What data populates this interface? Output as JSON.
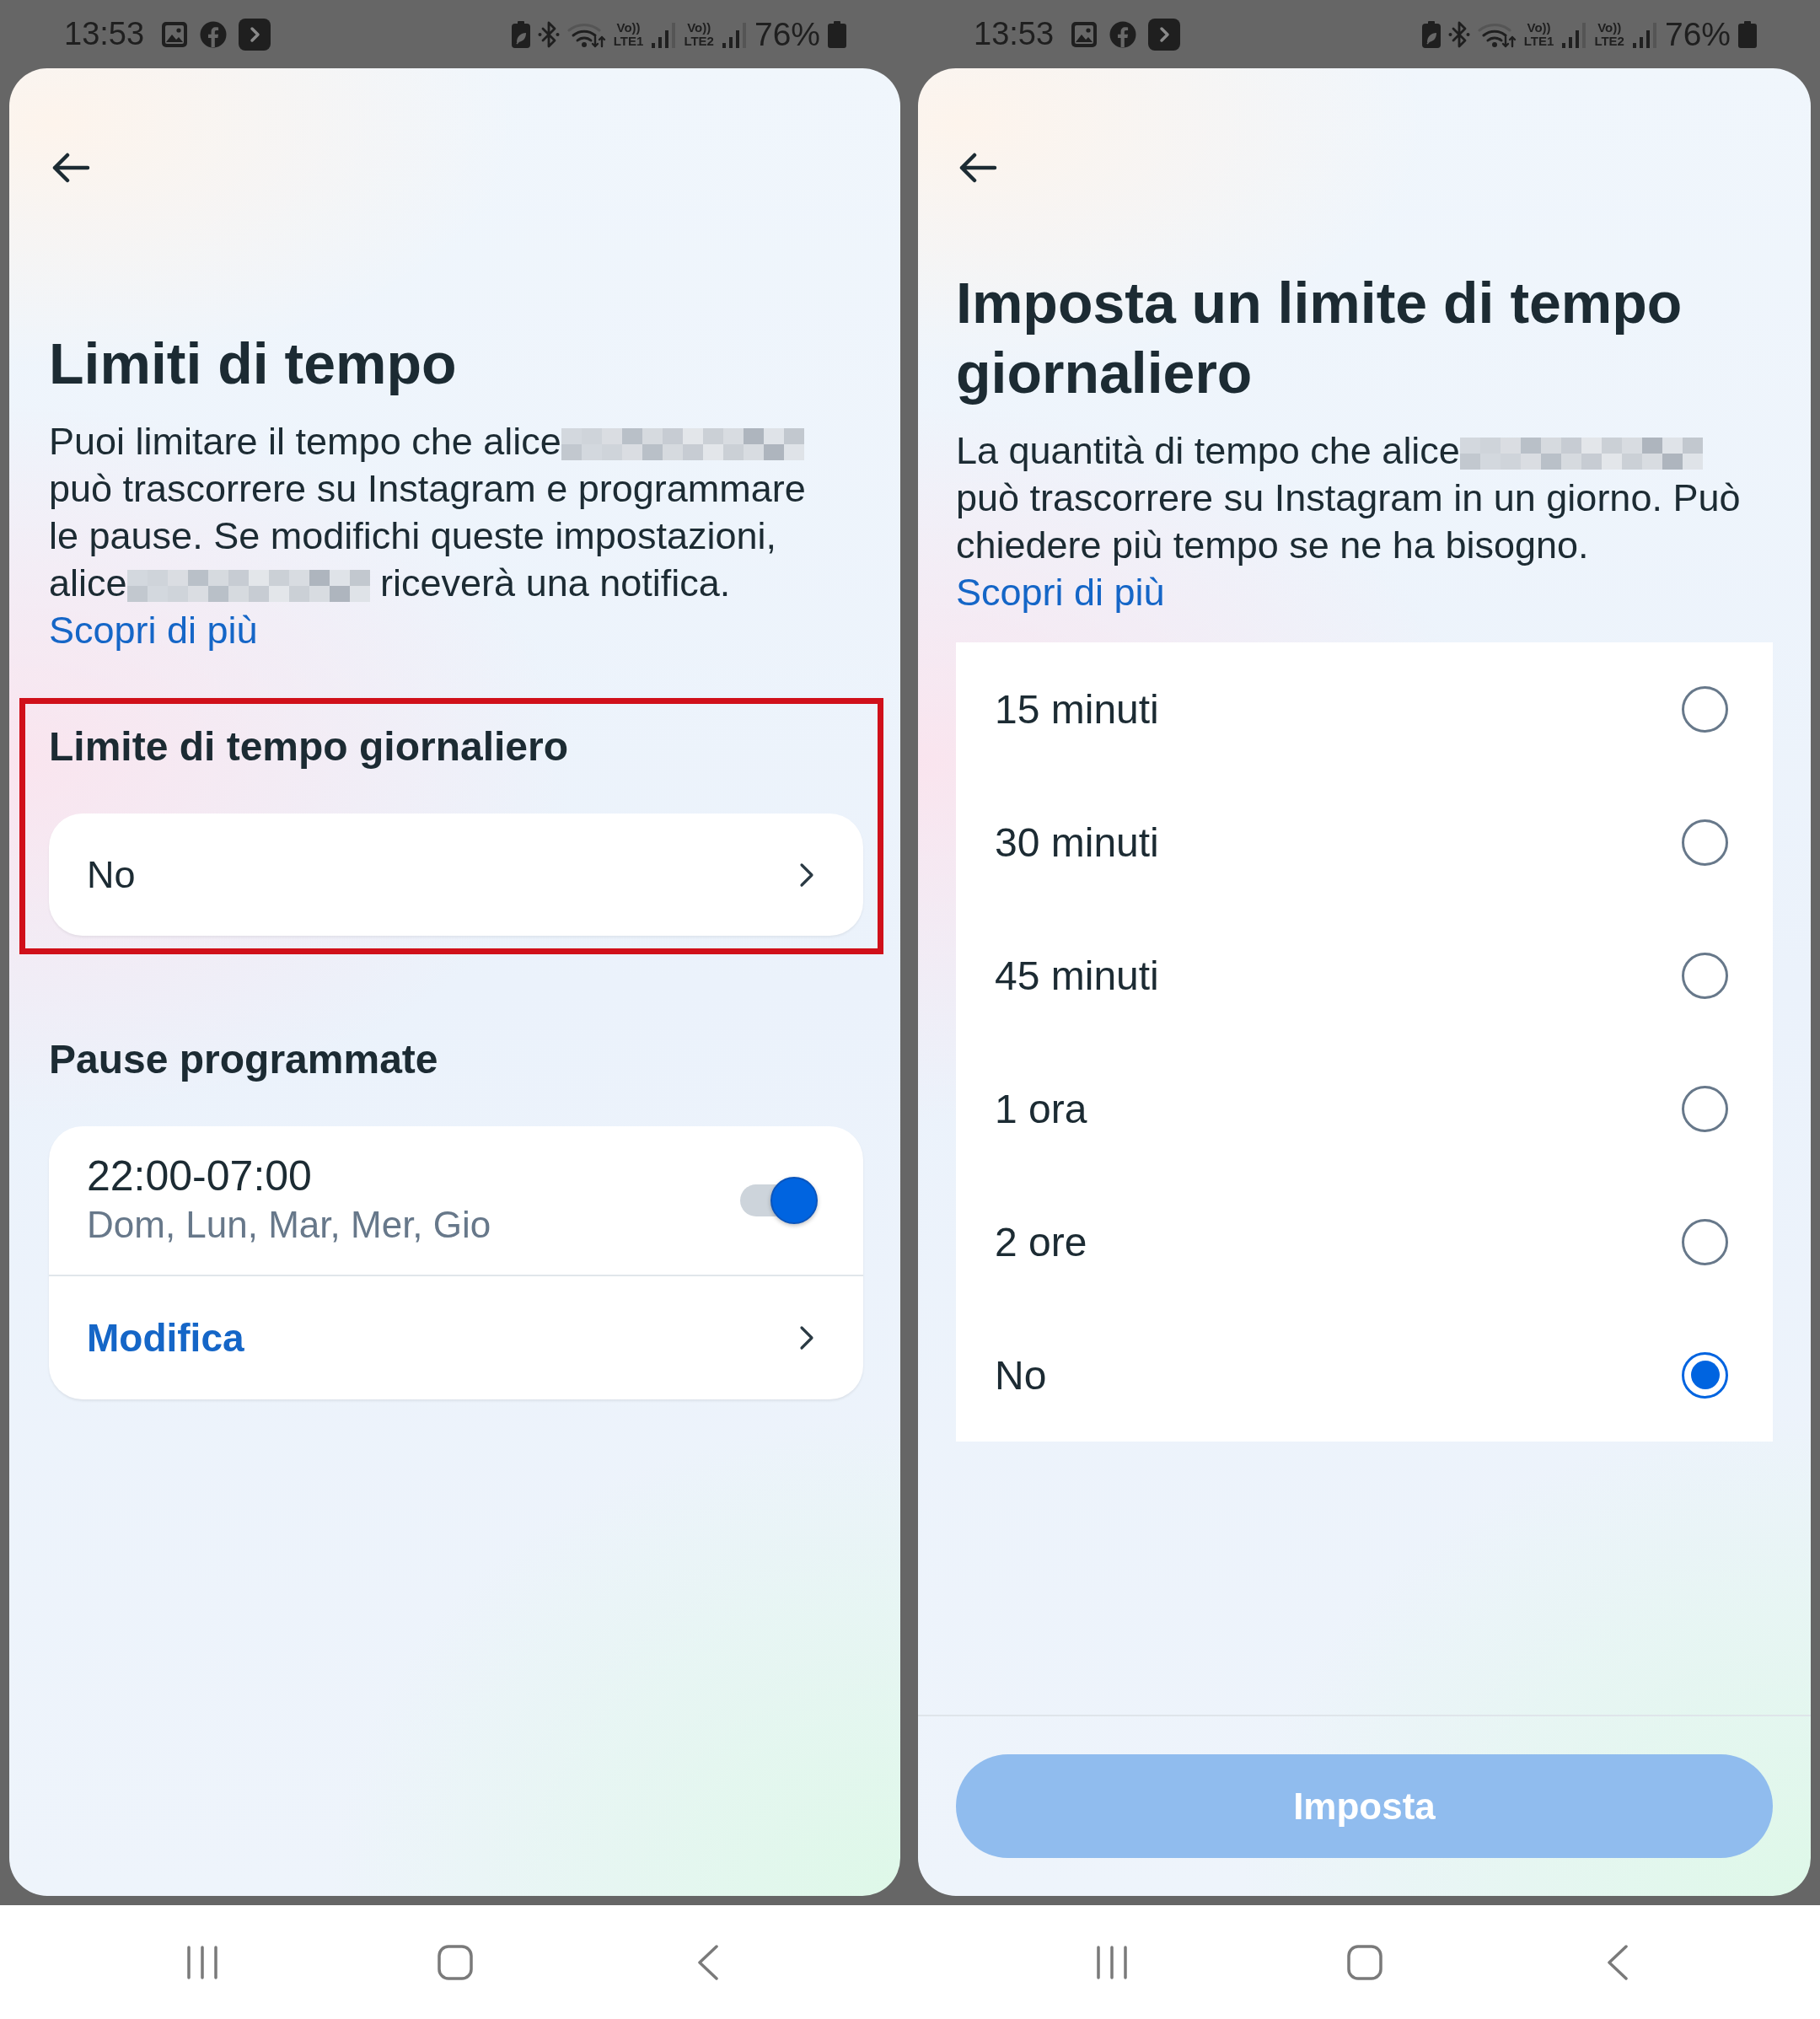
{
  "limits_screen": {
    "status_bar": {
      "time": "13:53",
      "networks": [
        {
          "volte": "Vo))",
          "type": "LTE1"
        },
        {
          "volte": "Vo))",
          "type": "LTE2"
        }
      ],
      "battery": "76%"
    },
    "title": "Limiti di tempo",
    "description": [
      {
        "kind": "text",
        "text": "Puoi limitare il tempo che alice"
      },
      {
        "kind": "redacted"
      },
      {
        "kind": "text",
        "text": "può trascorrere su Instagram e programmare le pause. Se modifichi queste impostazioni, alice"
      },
      {
        "kind": "redacted"
      },
      {
        "kind": "text",
        "text": "riceverà una notifica."
      },
      {
        "kind": "link",
        "text": "Scopri di più"
      }
    ],
    "sections": [
      {
        "kind": "select",
        "heading": "Limite di tempo giornaliero",
        "highlighted": true,
        "value": "No"
      },
      {
        "kind": "schedule",
        "heading": "Pause programmate",
        "highlighted": false,
        "schedules": [
          {
            "time": "22:00-07:00",
            "days": "Dom, Lun, Mar, Mer, Gio",
            "on": true
          }
        ],
        "action": "Modifica"
      }
    ]
  },
  "daily_limit_screen": {
    "status_bar": {
      "time": "13:53",
      "networks": [
        {
          "volte": "Vo))",
          "type": "LTE1"
        },
        {
          "volte": "Vo))",
          "type": "LTE2"
        }
      ],
      "battery": "76%"
    },
    "title": "Imposta un limite di tempo giornaliero",
    "description": [
      {
        "kind": "text",
        "text": "La quantità di tempo che alice"
      },
      {
        "kind": "redacted"
      },
      {
        "kind": "text",
        "text": "può trascorrere su Instagram in un giorno. Può chiedere più tempo se ne ha bisogno."
      },
      {
        "kind": "link",
        "text": "Scopri di più"
      }
    ],
    "options": [
      {
        "label": "15 minuti",
        "selected": false
      },
      {
        "label": "30 minuti",
        "selected": false
      },
      {
        "label": "45 minuti",
        "selected": false
      },
      {
        "label": "1 ora",
        "selected": false
      },
      {
        "label": "2 ore",
        "selected": false
      },
      {
        "label": "No",
        "selected": true
      }
    ],
    "button": {
      "label": "Imposta",
      "disabled": true
    }
  }
}
